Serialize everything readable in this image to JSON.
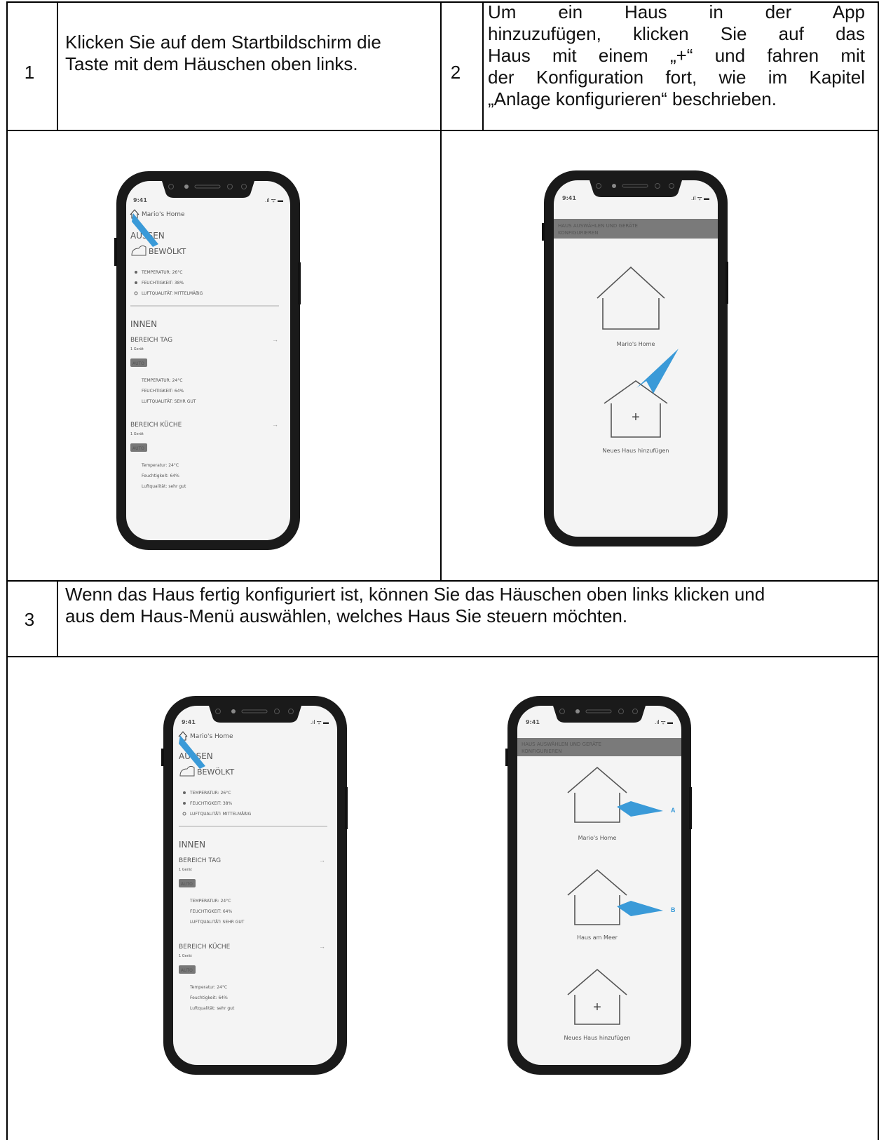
{
  "steps": [
    {
      "number": "1",
      "text": "Klicken Sie auf dem Startbildschirm die Taste mit dem Häuschen oben links."
    },
    {
      "number": "2",
      "lines": [
        "Um ein Haus in der App",
        "hinzuzufügen, klicken Sie auf das",
        "Haus mit einem „+“ und fahren mit",
        "der Konfiguration fort, wie im Kapitel",
        "„Anlage konfigurieren“ beschrieben."
      ]
    },
    {
      "number": "3",
      "text": "Wenn das Haus fertig konfiguriert ist, können Sie das Häuschen oben links klicken und aus dem Haus-Menü auswählen, welches Haus Sie steuern möchten."
    }
  ],
  "home_screen": {
    "time": "9:41",
    "home_name": "Mario's Home",
    "outside_heading": "AUSSEN",
    "weather": "BEWÖLKT",
    "outside_values": [
      "TEMPERATUR: 26°C",
      "FEUCHTIGKEIT: 38%",
      "LUFTQUALITÄT: MITTELMÄßIG"
    ],
    "inside_heading": "INNEN",
    "areas": [
      {
        "name": "BEREICH TAG",
        "devices": "1 Gerät",
        "mode": "AUTO",
        "values": [
          "TEMPERATUR: 24°C",
          "FEUCHTIGKEIT: 64%",
          "LUFTQUALITÄT: SEHR GUT"
        ]
      },
      {
        "name": "BEREICH KÜCHE",
        "devices": "1 Gerät",
        "mode": "AUTO",
        "values": [
          "Temperatur: 24°C",
          "Feuchtigkeit: 64%",
          "Luftqualität: sehr gut"
        ]
      }
    ]
  },
  "house_select_screen": {
    "time": "9:41",
    "header_line1": "HAUS AUSWÄHLEN UND GERÄTE",
    "header_line2": "KONFIGURIEREN",
    "houses": [
      "Mario's Home",
      "Haus am Meer"
    ],
    "add_label": "Neues Haus hinzufügen",
    "add_symbol": "+",
    "marker_a": "A",
    "marker_b": "B"
  },
  "colors": {
    "arrow": "#3a9ad8",
    "header_bar": "#7a7a7a",
    "phone_body": "#1a1a1a",
    "screen": "#f4f4f4"
  }
}
